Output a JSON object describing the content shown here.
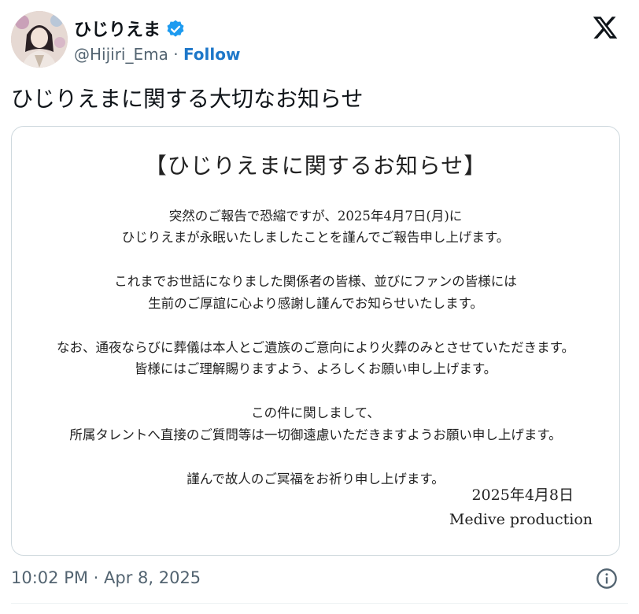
{
  "author": {
    "display_name": "ひじりえま",
    "handle": "@Hijiri_Ema",
    "separator": " · ",
    "follow_label": "Follow"
  },
  "tweet": {
    "text": "ひじりえまに関する大切なお知らせ",
    "timestamp": "10:02 PM · Apr 8, 2025"
  },
  "notice": {
    "title": "【ひじりえまに関するお知らせ】",
    "lines": [
      "突然のご報告で恐縮ですが、2025年4月7日(月)に",
      "ひじりえまが永眠いたしましたことを謹んでご報告申し上げます。",
      "これまでお世話になりました関係者の皆様、並びにファンの皆様には",
      "生前のご厚誼に心より感謝し謹んでお知らせいたします。",
      "なお、通夜ならびに葬儀は本人とご遺族のご意向により火葬のみとさせていただきます。",
      "皆様にはご理解賜りますよう、よろしくお願い申し上げます。",
      "この件に関しまして、",
      "所属タレントへ直接のご質問等は一切御遠慮いただきますようお願い申し上げます。",
      "謹んで故人のご冥福をお祈り申し上げます。"
    ],
    "date": "2025年4月8日",
    "organization": "Medive production"
  },
  "icons": {
    "verified": "verified-badge-icon",
    "platform": "x-logo-icon",
    "info": "info-icon"
  },
  "colors": {
    "link": "#1d77c9",
    "verified": "#1d9bf0",
    "secondary_text": "#536471",
    "border": "#cfd9de"
  }
}
